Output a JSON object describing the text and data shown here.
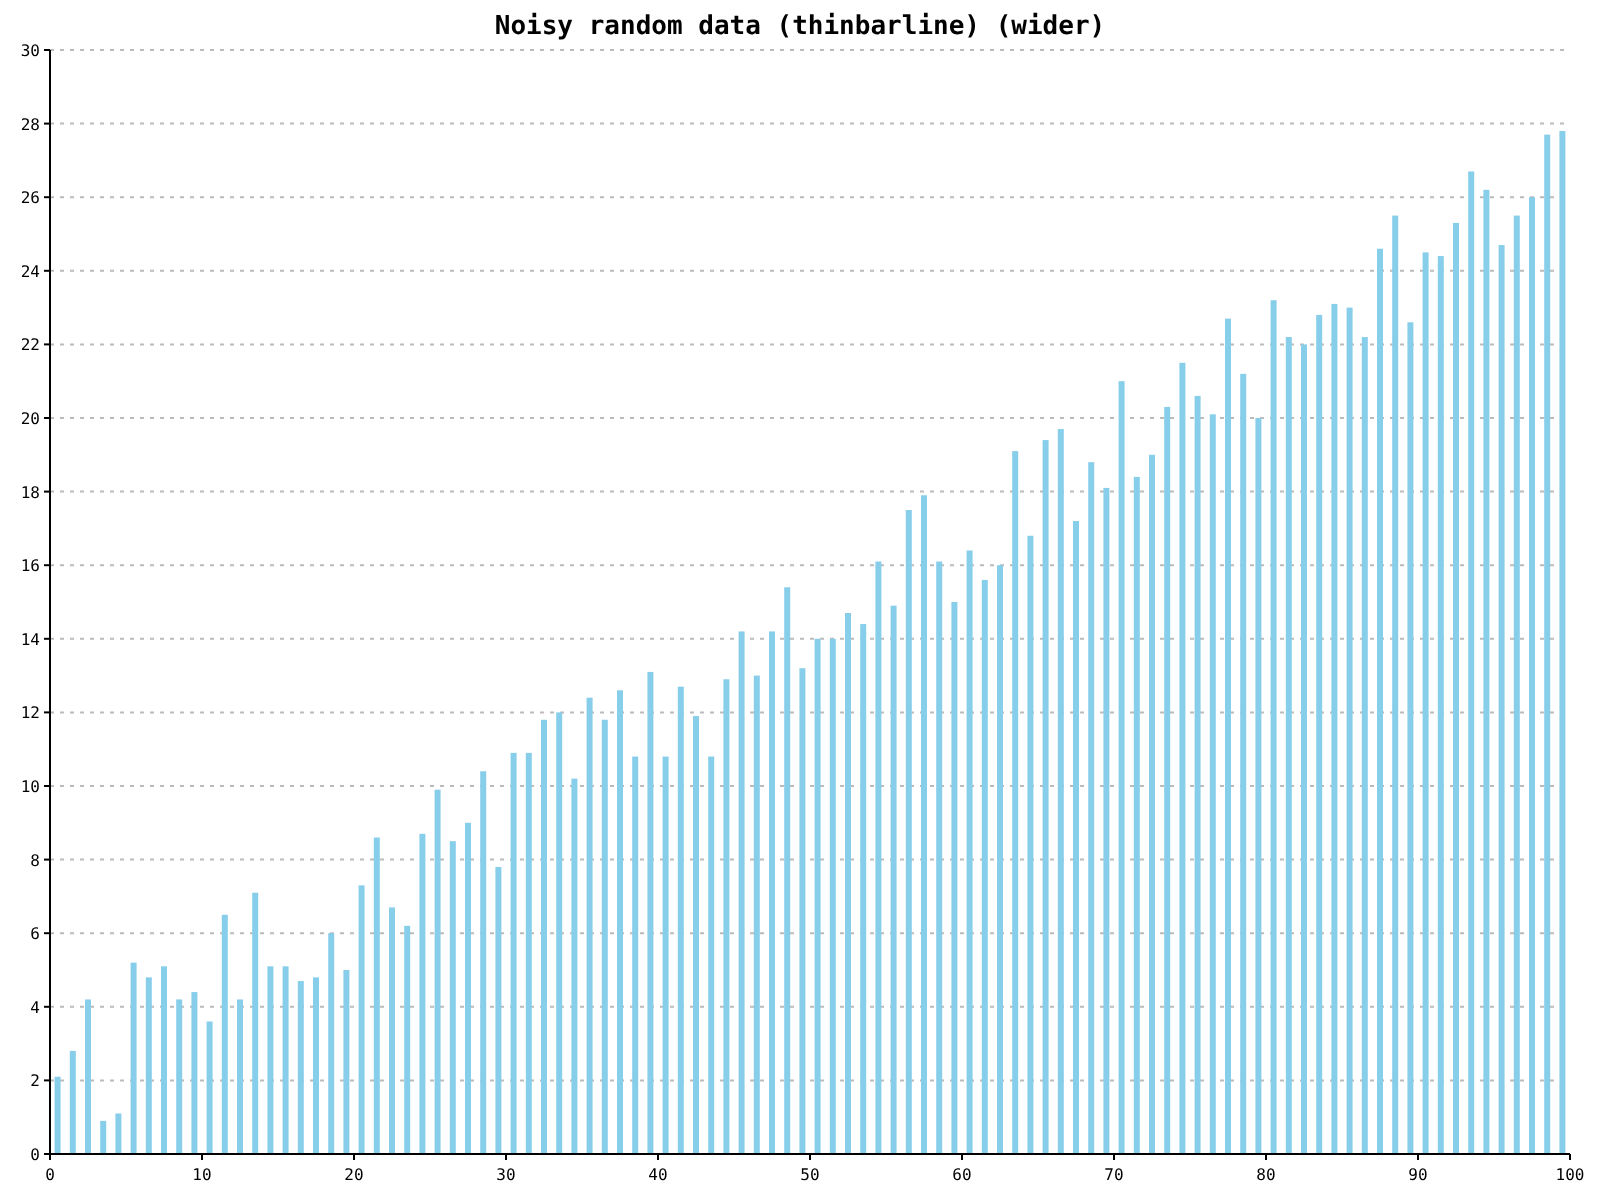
{
  "chart_data": {
    "type": "bar",
    "title": "Noisy random data (thinbarline) (wider)",
    "x": [
      0,
      1,
      2,
      3,
      4,
      5,
      6,
      7,
      8,
      9,
      10,
      11,
      12,
      13,
      14,
      15,
      16,
      17,
      18,
      19,
      20,
      21,
      22,
      23,
      24,
      25,
      26,
      27,
      28,
      29,
      30,
      31,
      32,
      33,
      34,
      35,
      36,
      37,
      38,
      39,
      40,
      41,
      42,
      43,
      44,
      45,
      46,
      47,
      48,
      49,
      50,
      51,
      52,
      53,
      54,
      55,
      56,
      57,
      58,
      59,
      60,
      61,
      62,
      63,
      64,
      65,
      66,
      67,
      68,
      69,
      70,
      71,
      72,
      73,
      74,
      75,
      76,
      77,
      78,
      79,
      80,
      81,
      82,
      83,
      84,
      85,
      86,
      87,
      88,
      89,
      90,
      91,
      92,
      93,
      94,
      95,
      96,
      97,
      98,
      99
    ],
    "grid": true,
    "series": [
      {
        "color": "#87ceeb",
        "values": [
          2.1,
          2.8,
          4.2,
          0.9,
          1.1,
          5.2,
          4.8,
          5.1,
          4.2,
          4.4,
          3.6,
          6.5,
          4.2,
          7.1,
          5.1,
          5.1,
          4.7,
          4.8,
          6.0,
          5.0,
          7.3,
          8.6,
          6.7,
          6.2,
          8.7,
          9.9,
          8.5,
          9.0,
          10.4,
          7.8,
          10.9,
          10.9,
          11.8,
          12.0,
          10.2,
          12.4,
          11.8,
          12.6,
          10.8,
          13.1,
          10.8,
          12.7,
          11.9,
          10.8,
          12.9,
          14.2,
          13.0,
          14.2,
          15.4,
          13.2,
          14.0,
          14.0,
          14.7,
          14.4,
          16.1,
          14.9,
          17.5,
          17.9,
          16.1,
          15.0,
          16.4,
          15.6,
          16.0,
          19.1,
          16.8,
          19.4,
          19.7,
          17.2,
          18.8,
          18.1,
          21.0,
          18.4,
          19.0,
          20.3,
          21.5,
          20.6,
          20.1,
          22.7,
          21.2,
          20.0,
          23.2,
          22.2,
          22.0,
          22.8,
          23.1,
          23.0,
          22.2,
          24.6,
          25.5,
          22.6,
          24.5,
          24.4,
          25.3,
          26.7,
          26.2,
          24.7,
          25.5,
          26.0,
          27.7,
          27.8
        ]
      }
    ],
    "xlim": [
      0,
      100
    ],
    "ylim": [
      0,
      30
    ],
    "xticks": [
      0,
      10,
      20,
      30,
      40,
      50,
      60,
      70,
      80,
      90,
      100
    ],
    "yticks": [
      0,
      2,
      4,
      6,
      8,
      10,
      12,
      14,
      16,
      18,
      20,
      22,
      24,
      26,
      28,
      30
    ]
  }
}
